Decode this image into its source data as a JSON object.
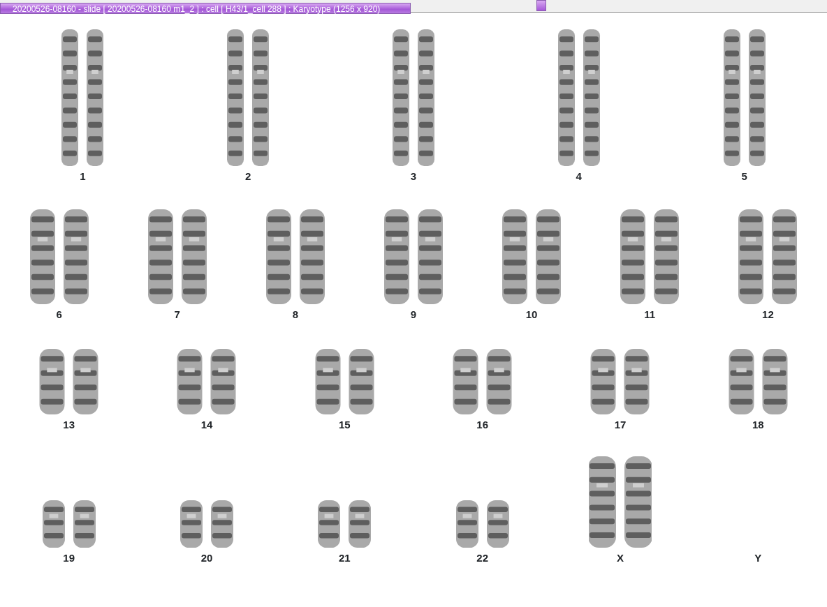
{
  "window": {
    "title": "20200526-08160 - slide [ 20200526-08160 m1_2 ] : cell [ H43/1_cell 288 ] : Karyotype  (1256 x 920)"
  },
  "rows": [
    {
      "items": [
        {
          "label": "1",
          "kind": "pair"
        },
        {
          "label": "2",
          "kind": "pair"
        },
        {
          "label": "3",
          "kind": "pair"
        },
        {
          "label": "4",
          "kind": "pair"
        },
        {
          "label": "5",
          "kind": "pair"
        }
      ]
    },
    {
      "items": [
        {
          "label": "6",
          "kind": "pair"
        },
        {
          "label": "7",
          "kind": "pair"
        },
        {
          "label": "8",
          "kind": "pair"
        },
        {
          "label": "9",
          "kind": "pair"
        },
        {
          "label": "10",
          "kind": "pair"
        },
        {
          "label": "11",
          "kind": "pair"
        },
        {
          "label": "12",
          "kind": "pair"
        }
      ]
    },
    {
      "items": [
        {
          "label": "13",
          "kind": "pair"
        },
        {
          "label": "14",
          "kind": "pair"
        },
        {
          "label": "15",
          "kind": "pair"
        },
        {
          "label": "16",
          "kind": "pair"
        },
        {
          "label": "17",
          "kind": "pair"
        },
        {
          "label": "18",
          "kind": "pair"
        }
      ]
    },
    {
      "items": [
        {
          "label": "19",
          "kind": "pair"
        },
        {
          "label": "20",
          "kind": "pair"
        },
        {
          "label": "21",
          "kind": "pair"
        },
        {
          "label": "22",
          "kind": "pair"
        },
        {
          "label": "X",
          "kind": "tall-pair"
        },
        {
          "label": "Y",
          "kind": "empty"
        }
      ]
    }
  ]
}
